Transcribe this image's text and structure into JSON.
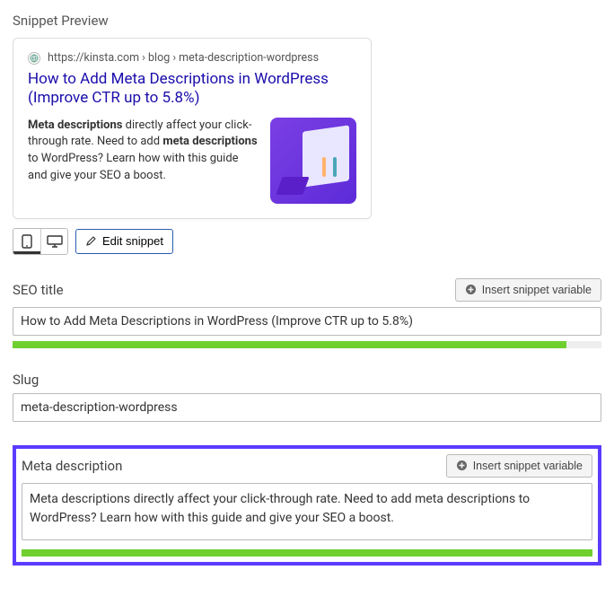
{
  "header": {
    "snippet_preview": "Snippet Preview"
  },
  "preview": {
    "url": "https://kinsta.com › blog › meta-description-wordpress",
    "title": "How to Add Meta Descriptions in WordPress (Improve CTR up to 5.8%)",
    "desc_bold1": "Meta descriptions",
    "desc_mid1": " directly affect your click-through rate. Need to add ",
    "desc_bold2": "meta descriptions",
    "desc_mid2": " to WordPress? Learn how with this guide and give your SEO a boost."
  },
  "toolbar": {
    "edit_snippet": "Edit snippet"
  },
  "fields": {
    "seo_title_label": "SEO title",
    "seo_title_value": "How to Add Meta Descriptions in WordPress (Improve CTR up to 5.8%)",
    "slug_label": "Slug",
    "slug_value": "meta-description-wordpress",
    "meta_desc_label": "Meta description",
    "meta_desc_value": "Meta descriptions directly affect your click-through rate. Need to add meta descriptions to WordPress? Learn how with this guide and give your SEO a boost.",
    "insert_variable": "Insert snippet variable"
  },
  "progress": {
    "seo_title_pct": "94%",
    "meta_desc_pct": "100%"
  }
}
